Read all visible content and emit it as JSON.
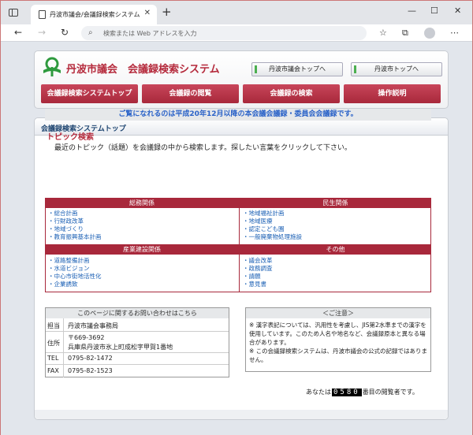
{
  "browser": {
    "tab_title": "丹波市議会/会議録検索システム",
    "address_placeholder": "検索または Web アドレスを入力"
  },
  "header": {
    "site_title": "丹波市議会　会議録検索システム",
    "links": [
      "丹波市議会トップへ",
      "丹波市トップへ"
    ],
    "menu": [
      "会議録検索システムトップ",
      "会議録の閲覧",
      "会議録の検索",
      "操作説明"
    ]
  },
  "content": {
    "panel_title": "会議録検索システムトップ",
    "notice": "ご覧になれるのは平成20年12月以降の本会議会議録・委員会会議録です。",
    "topic_heading": "トピック検索",
    "topic_desc": "最近のトピック（話題）を会議録の中から検索します。探したい言葉をクリックして下さい。",
    "categories": [
      {
        "title": "総務関係",
        "items": [
          "総合計画",
          "行財政改革",
          "地域づくり",
          "教育振興基本計画"
        ]
      },
      {
        "title": "民生関係",
        "items": [
          "地域福祉計画",
          "地域医療",
          "認定こども園",
          "一般廃棄物処理施設"
        ]
      },
      {
        "title": "産業建設関係",
        "items": [
          "道路整備計画",
          "水道ビジョン",
          "中心市街地活性化",
          "企業誘致"
        ]
      },
      {
        "title": "その他",
        "items": [
          "議会改革",
          "政務調査",
          "請願",
          "意見書"
        ]
      }
    ]
  },
  "contact": {
    "heading": "このページに関するお問い合わせはこちら",
    "rows": [
      {
        "label": "担当",
        "value": "丹波市議会事務局"
      },
      {
        "label": "住所",
        "value": "〒669-3692",
        "value2": "兵庫県丹波市氷上町成松字甲賀1番地"
      },
      {
        "label": "TEL",
        "value": "0795-82-1472"
      },
      {
        "label": "FAX",
        "value": "0795-82-1523"
      }
    ]
  },
  "caution": {
    "heading": "＜ご注意＞",
    "text1": "※ 漢字表記については、汎用性を考慮し、JIS第2水準までの漢字を使用しています。このため人名や地名など、会議録原本と異なる場合があります。",
    "text2": "※ この会議録検索システムは、丹波市議会の公式の記録ではありません。"
  },
  "counter": {
    "prefix": "あなたは",
    "value": "0580",
    "suffix": "番目の閲覧者です。"
  },
  "colors": {
    "accent": "#a8283b",
    "title": "#b52a3c",
    "link": "#1a5fb4",
    "notice": "#2a62c8"
  }
}
